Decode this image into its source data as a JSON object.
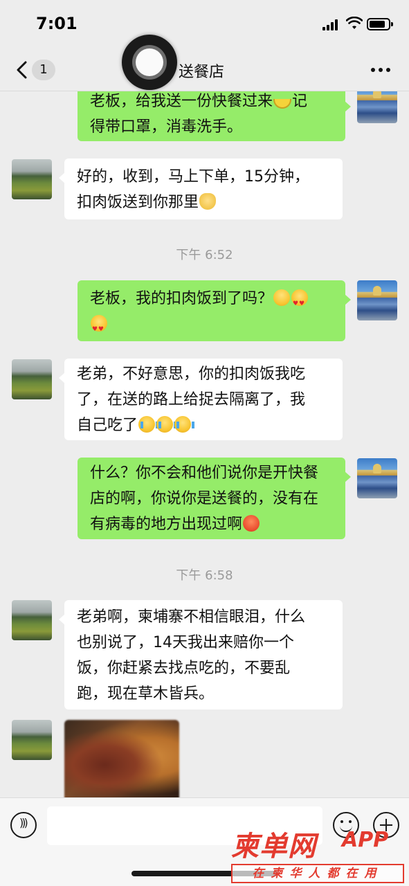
{
  "status_bar": {
    "time": "7:01"
  },
  "nav": {
    "unread_count": "1",
    "title": "送餐店"
  },
  "messages": [
    {
      "sender": "self",
      "text": "老板，给我送一份快餐过来",
      "emoji_after": "banana",
      "text2": "记得带口罩，消毒洗手。"
    },
    {
      "sender": "other",
      "text": "好的，收到，马上下单，15分钟，扣肉饭送到你那里",
      "emoji_after": "ok-hand"
    },
    {
      "timestamp": "下午 6:52"
    },
    {
      "sender": "self",
      "text": "老板，我的扣肉饭到了吗？",
      "emojis": [
        "laugh",
        "heart-eyes",
        "heart-eyes"
      ]
    },
    {
      "sender": "other",
      "text": "老弟，不好意思，你的扣肉饭我吃了，在送的路上给捉去隔离了，我自己吃了",
      "emojis": [
        "crying",
        "crying",
        "crying"
      ]
    },
    {
      "sender": "self",
      "text": "什么？你不会和他们说你是开快餐店的啊，你说你是送餐的，没有在有病毒的地方出现过啊",
      "emojis": [
        "angry"
      ]
    },
    {
      "timestamp": "下午 6:58"
    },
    {
      "sender": "other",
      "text": "老弟啊，柬埔寨不相信眼泪，什么也别说了，14天我出来赔你一个饭，你赶紧去找点吃的，不要乱跑，现在草木皆兵。"
    },
    {
      "sender": "other",
      "type": "image",
      "content": "pork-rice-photo"
    }
  ],
  "lines": {
    "m1a": "老板，给我送一份快餐过来",
    "m1b": "记",
    "m1c": "得带口罩，消毒洗手。",
    "m2a": "好的，收到，马上下单，15分钟，",
    "m2b": "扣肉饭送到你那里",
    "t1": "下午 6:52",
    "m3a": "老板，我的扣肉饭到了吗？",
    "m4a": "老弟，不好意思，你的扣肉饭我吃",
    "m4b": "了，在送的路上给捉去隔离了，我",
    "m4c": "自己吃了",
    "m5a": "什么？你不会和他们说你是开快餐",
    "m5b": "店的啊，你说你是送餐的，没有在",
    "m5c": "有病毒的地方出现过啊",
    "t2": "下午 6:58",
    "m6a": "老弟啊，柬埔寨不相信眼泪，什么",
    "m6b": "也别说了，14天我出来赔你一个",
    "m6c": "饭，你赶紧去找点吃的，不要乱",
    "m6d": "跑，现在草木皆兵。"
  },
  "watermark": {
    "main": "柬单网",
    "app": "APP",
    "slogan": "在柬华人都在用"
  },
  "colors": {
    "self_bubble": "#95ec69",
    "other_bubble": "#ffffff",
    "background": "#ededed",
    "watermark": "#e33b2f"
  },
  "icons": [
    "back-icon",
    "more-icon",
    "voice-icon",
    "emoji-icon",
    "plus-icon",
    "assistive-touch"
  ]
}
